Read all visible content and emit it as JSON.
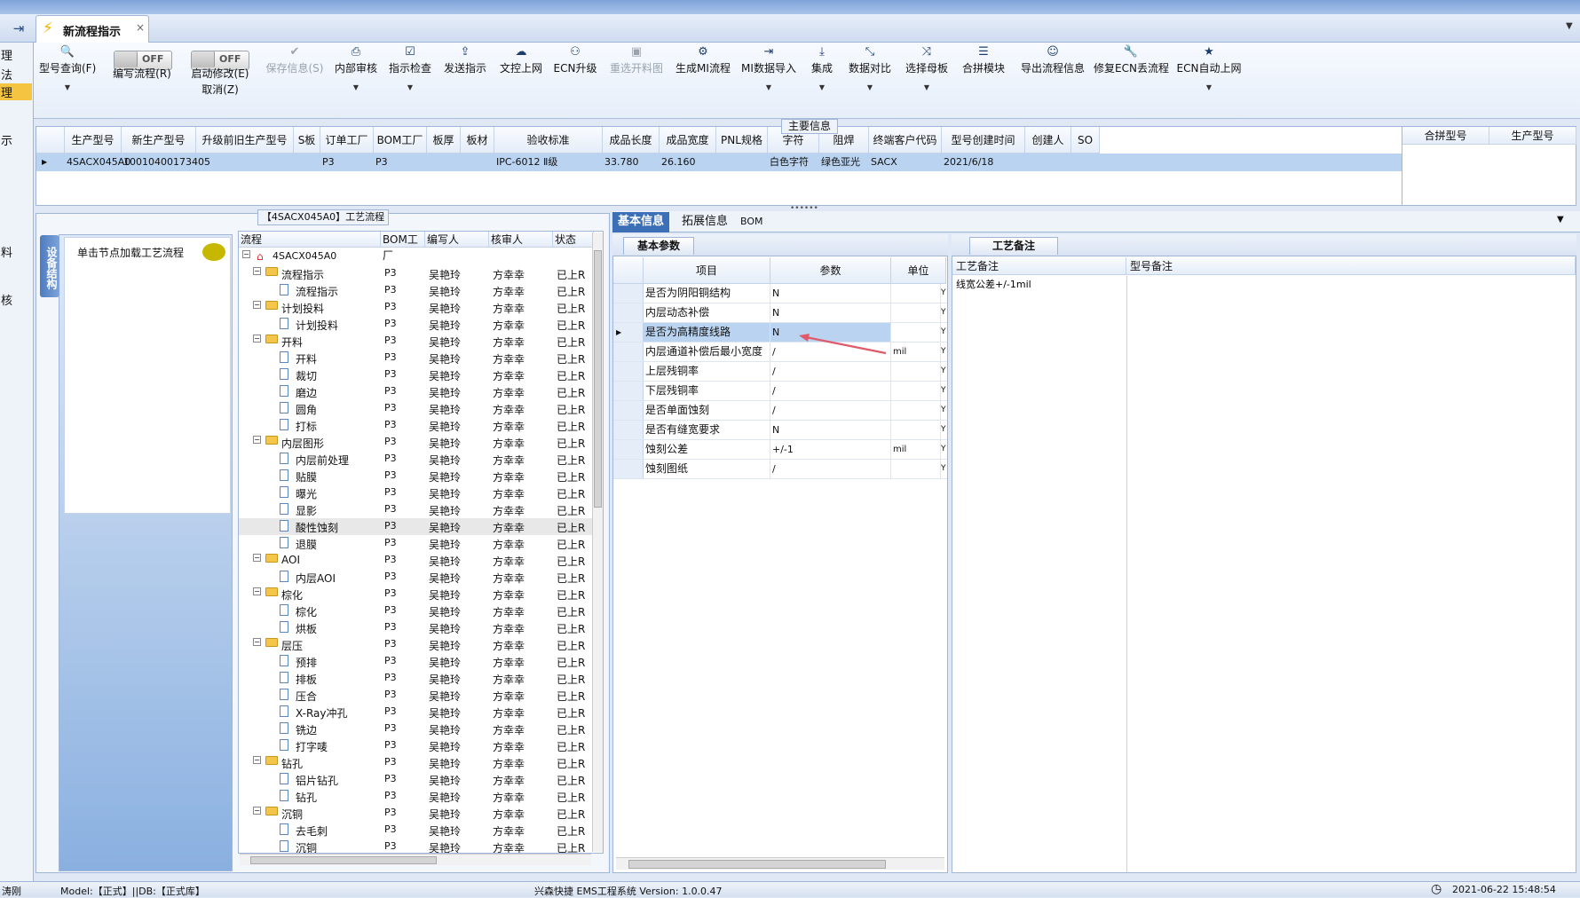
{
  "window": {
    "style_label": "Style"
  },
  "tabs": [
    {
      "label": "新流程指示",
      "close": "×"
    }
  ],
  "left_strip": [
    "理",
    "法",
    "理",
    "示",
    "料",
    "核"
  ],
  "toolbar": {
    "items": [
      {
        "label": "型号查询(F)",
        "icon": "search-icon",
        "glyph": "🔍",
        "dropdown": true
      },
      {
        "label": "编写流程(R)",
        "toggle": "OFF"
      },
      {
        "label": "启动修改(E)",
        "label2": "取消(Z)",
        "toggle": "OFF"
      },
      {
        "label": "保存信息(S)",
        "icon": "check-icon",
        "glyph": "✔",
        "disabled": true
      },
      {
        "label": "内部审核",
        "icon": "print-icon",
        "glyph": "⎙",
        "dropdown": true
      },
      {
        "label": "指示检查",
        "icon": "checkbox-icon",
        "glyph": "☑",
        "dropdown": true
      },
      {
        "label": "发送指示",
        "icon": "upload-icon",
        "glyph": "⇪"
      },
      {
        "label": "文控上网",
        "icon": "cloud-upload-icon",
        "glyph": "☁"
      },
      {
        "label": "ECN升级",
        "icon": "binoculars-icon",
        "glyph": "⚇"
      },
      {
        "label": "重选开料图",
        "icon": "image-icon",
        "glyph": "▣",
        "disabled": true
      },
      {
        "label": "生成MI流程",
        "icon": "gears-icon",
        "glyph": "⚙"
      },
      {
        "label": "MI数据导入",
        "icon": "import-icon",
        "glyph": "⇥",
        "dropdown": true
      },
      {
        "label": "集成",
        "icon": "download-icon",
        "glyph": "⤓",
        "dropdown": true
      },
      {
        "label": "数据对比",
        "icon": "compare-icon",
        "glyph": "⤡",
        "dropdown": true
      },
      {
        "label": "选择母板",
        "icon": "random-icon",
        "glyph": "⤨",
        "dropdown": true
      },
      {
        "label": "合拼模块",
        "icon": "list-icon",
        "glyph": "☰"
      },
      {
        "label": "导出流程信息",
        "icon": "smile-icon",
        "glyph": "☺"
      },
      {
        "label": "修复ECN丢流程",
        "icon": "wrench-icon",
        "glyph": "🔧"
      },
      {
        "label": "ECN自动上网",
        "icon": "star-icon",
        "glyph": "★",
        "dropdown": true
      }
    ]
  },
  "main_info": {
    "title": "主要信息",
    "columns": [
      "生产型号",
      "新生产型号",
      "升级前旧生产型号",
      "S板",
      "订单工厂",
      "BOM工厂",
      "板厚",
      "板材",
      "验收标准",
      "成品长度",
      "成品宽度",
      "PNL规格",
      "字符",
      "阻焊",
      "终端客户代码",
      "型号创建时间",
      "创建人",
      "SO"
    ],
    "row": [
      "4SACX045A0",
      "10010400173405",
      "",
      "",
      "P3",
      "P3",
      "",
      "",
      "IPC-6012 Ⅱ级",
      "33.780",
      "26.160",
      "",
      "白色字符",
      "绿色亚光",
      "SACX",
      "2021/6/18",
      "",
      ""
    ],
    "merge_columns": [
      "合拼型号",
      "生产型号"
    ]
  },
  "process": {
    "title": "【4SACX045A0】工艺流程",
    "side_tab": "设备结构",
    "hint": "单击节点加载工艺流程",
    "columns": [
      "流程",
      "BOM工厂",
      "编写人",
      "核审人",
      "状态"
    ],
    "root": "4SACX045A0",
    "rows": [
      {
        "name": "流程指示",
        "level": 1,
        "folder": true,
        "bom": "P3",
        "writer": "吴艳玲",
        "reviewer": "方幸幸",
        "status": "已上R"
      },
      {
        "name": "流程指示",
        "level": 2,
        "bom": "P3",
        "writer": "吴艳玲",
        "reviewer": "方幸幸",
        "status": "已上R"
      },
      {
        "name": "计划投料",
        "level": 1,
        "folder": true,
        "bom": "P3",
        "writer": "吴艳玲",
        "reviewer": "方幸幸",
        "status": "已上R"
      },
      {
        "name": "计划投料",
        "level": 2,
        "bom": "P3",
        "writer": "吴艳玲",
        "reviewer": "方幸幸",
        "status": "已上R"
      },
      {
        "name": "开料",
        "level": 1,
        "folder": true,
        "bom": "P3",
        "writer": "吴艳玲",
        "reviewer": "方幸幸",
        "status": "已上R"
      },
      {
        "name": "开料",
        "level": 2,
        "bom": "P3",
        "writer": "吴艳玲",
        "reviewer": "方幸幸",
        "status": "已上R"
      },
      {
        "name": "裁切",
        "level": 2,
        "bom": "P3",
        "writer": "吴艳玲",
        "reviewer": "方幸幸",
        "status": "已上R"
      },
      {
        "name": "磨边",
        "level": 2,
        "bom": "P3",
        "writer": "吴艳玲",
        "reviewer": "方幸幸",
        "status": "已上R"
      },
      {
        "name": "圆角",
        "level": 2,
        "bom": "P3",
        "writer": "吴艳玲",
        "reviewer": "方幸幸",
        "status": "已上R"
      },
      {
        "name": "打标",
        "level": 2,
        "bom": "P3",
        "writer": "吴艳玲",
        "reviewer": "方幸幸",
        "status": "已上R"
      },
      {
        "name": "内层图形",
        "level": 1,
        "folder": true,
        "bom": "P3",
        "writer": "吴艳玲",
        "reviewer": "方幸幸",
        "status": "已上R"
      },
      {
        "name": "内层前处理",
        "level": 2,
        "bom": "P3",
        "writer": "吴艳玲",
        "reviewer": "方幸幸",
        "status": "已上R"
      },
      {
        "name": "贴膜",
        "level": 2,
        "bom": "P3",
        "writer": "吴艳玲",
        "reviewer": "方幸幸",
        "status": "已上R"
      },
      {
        "name": "曝光",
        "level": 2,
        "bom": "P3",
        "writer": "吴艳玲",
        "reviewer": "方幸幸",
        "status": "已上R"
      },
      {
        "name": "显影",
        "level": 2,
        "bom": "P3",
        "writer": "吴艳玲",
        "reviewer": "方幸幸",
        "status": "已上R"
      },
      {
        "name": "酸性蚀刻",
        "level": 2,
        "bom": "P3",
        "writer": "吴艳玲",
        "reviewer": "方幸幸",
        "status": "已上R",
        "selected": true
      },
      {
        "name": "退膜",
        "level": 2,
        "bom": "P3",
        "writer": "吴艳玲",
        "reviewer": "方幸幸",
        "status": "已上R"
      },
      {
        "name": "AOI",
        "level": 1,
        "folder": true,
        "bom": "P3",
        "writer": "吴艳玲",
        "reviewer": "方幸幸",
        "status": "已上R"
      },
      {
        "name": "内层AOI",
        "level": 2,
        "bom": "P3",
        "writer": "吴艳玲",
        "reviewer": "方幸幸",
        "status": "已上R"
      },
      {
        "name": "棕化",
        "level": 1,
        "folder": true,
        "bom": "P3",
        "writer": "吴艳玲",
        "reviewer": "方幸幸",
        "status": "已上R"
      },
      {
        "name": "棕化",
        "level": 2,
        "bom": "P3",
        "writer": "吴艳玲",
        "reviewer": "方幸幸",
        "status": "已上R"
      },
      {
        "name": "烘板",
        "level": 2,
        "bom": "P3",
        "writer": "吴艳玲",
        "reviewer": "方幸幸",
        "status": "已上R"
      },
      {
        "name": "层压",
        "level": 1,
        "folder": true,
        "bom": "P3",
        "writer": "吴艳玲",
        "reviewer": "方幸幸",
        "status": "已上R"
      },
      {
        "name": "预排",
        "level": 2,
        "bom": "P3",
        "writer": "吴艳玲",
        "reviewer": "方幸幸",
        "status": "已上R"
      },
      {
        "name": "排板",
        "level": 2,
        "bom": "P3",
        "writer": "吴艳玲",
        "reviewer": "方幸幸",
        "status": "已上R"
      },
      {
        "name": "压合",
        "level": 2,
        "bom": "P3",
        "writer": "吴艳玲",
        "reviewer": "方幸幸",
        "status": "已上R"
      },
      {
        "name": "X-Ray冲孔",
        "level": 2,
        "bom": "P3",
        "writer": "吴艳玲",
        "reviewer": "方幸幸",
        "status": "已上R"
      },
      {
        "name": "铣边",
        "level": 2,
        "bom": "P3",
        "writer": "吴艳玲",
        "reviewer": "方幸幸",
        "status": "已上R"
      },
      {
        "name": "打字唛",
        "level": 2,
        "bom": "P3",
        "writer": "吴艳玲",
        "reviewer": "方幸幸",
        "status": "已上R"
      },
      {
        "name": "钻孔",
        "level": 1,
        "folder": true,
        "bom": "P3",
        "writer": "吴艳玲",
        "reviewer": "方幸幸",
        "status": "已上R"
      },
      {
        "name": "铝片钻孔",
        "level": 2,
        "bom": "P3",
        "writer": "吴艳玲",
        "reviewer": "方幸幸",
        "status": "已上R"
      },
      {
        "name": "钻孔",
        "level": 2,
        "bom": "P3",
        "writer": "吴艳玲",
        "reviewer": "方幸幸",
        "status": "已上R"
      },
      {
        "name": "沉铜",
        "level": 1,
        "folder": true,
        "bom": "P3",
        "writer": "吴艳玲",
        "reviewer": "方幸幸",
        "status": "已上R"
      },
      {
        "name": "去毛刺",
        "level": 2,
        "bom": "P3",
        "writer": "吴艳玲",
        "reviewer": "方幸幸",
        "status": "已上R"
      },
      {
        "name": "沉铜",
        "level": 2,
        "bom": "P3",
        "writer": "吴艳玲",
        "reviewer": "方幸幸",
        "status": "已上R"
      }
    ]
  },
  "basic_info": {
    "tabs": [
      "基本信息",
      "拓展信息",
      "BOM"
    ],
    "params_title": "基本参数",
    "columns": [
      "项目",
      "参数",
      "单位"
    ],
    "rows": [
      {
        "item": "是否为阴阳铜结构",
        "value": "N",
        "unit": ""
      },
      {
        "item": "内层动态补偿",
        "value": "N",
        "unit": ""
      },
      {
        "item": "是否为高精度线路",
        "value": "N",
        "unit": "",
        "selected": true
      },
      {
        "item": "内层通道补偿后最小宽度",
        "value": "/",
        "unit": "mil"
      },
      {
        "item": "上层残铜率",
        "value": "/",
        "unit": ""
      },
      {
        "item": "下层残铜率",
        "value": "/",
        "unit": ""
      },
      {
        "item": "是否单面蚀刻",
        "value": "/",
        "unit": ""
      },
      {
        "item": "是否有缝宽要求",
        "value": "N",
        "unit": ""
      },
      {
        "item": "蚀刻公差",
        "value": "+/-1",
        "unit": "mil"
      },
      {
        "item": "蚀刻图纸",
        "value": "/",
        "unit": ""
      }
    ],
    "trailing_col_value": "Y"
  },
  "notes": {
    "title": "工艺备注",
    "columns": [
      "工艺备注",
      "型号备注"
    ],
    "process_note": "线宽公差+/-1mil",
    "model_note": ""
  },
  "statusbar": {
    "left": "涛刚",
    "model": "Model:【正式】||DB:【正式库】",
    "system": "兴森快捷 EMS工程系统 Version: 1.0.0.47",
    "datetime": "2021-06-22 15:48:54"
  },
  "colors": {
    "accent": "#3d6fb6",
    "selection": "#b9d3f0",
    "arrow": "#e05a6a"
  }
}
